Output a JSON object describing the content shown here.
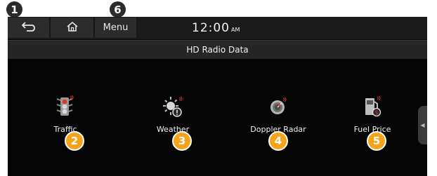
{
  "callouts": [
    "1",
    "2",
    "3",
    "4",
    "5",
    "6"
  ],
  "topbar": {
    "back_icon": "back-arrow-icon",
    "home_icon": "home-icon",
    "menu_label": "Menu",
    "clock": "12:00",
    "ampm": "AM"
  },
  "title": "HD Radio Data",
  "tiles": [
    {
      "label": "Traffic",
      "icon": "traffic-light-icon"
    },
    {
      "label": "Weather",
      "icon": "weather-icon"
    },
    {
      "label": "Doppler Radar",
      "icon": "doppler-radar-icon"
    },
    {
      "label": "Fuel Price",
      "icon": "fuel-pump-icon"
    }
  ],
  "colors": {
    "callout_light": "#f7a21b",
    "callout_dark": "#2b2b2b",
    "screen_bg": "#050505",
    "signal_red": "#e0342c"
  }
}
